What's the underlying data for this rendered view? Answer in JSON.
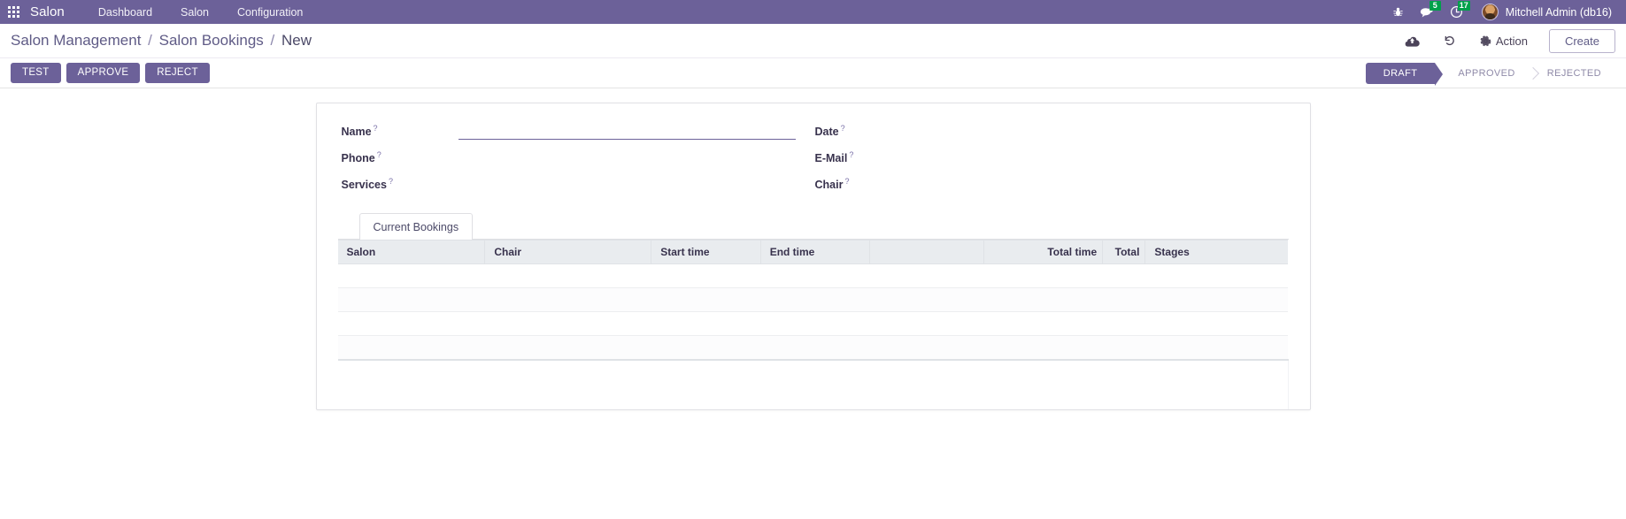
{
  "navbar": {
    "apps_icon": "apps-grid-icon",
    "brand": "Salon",
    "menu": [
      {
        "label": "Dashboard"
      },
      {
        "label": "Salon"
      },
      {
        "label": "Configuration"
      }
    ],
    "debug_icon": "bug-icon",
    "messages_icon": "chat-bubble-icon",
    "messages_count": "5",
    "activities_icon": "clock-icon",
    "activities_count": "17",
    "avatar_icon": "user-avatar",
    "username": "Mitchell Admin (db16)",
    "background_color": "#6c6199",
    "badge_color": "#00a04a"
  },
  "breadcrumb": {
    "root": "Salon Management",
    "parent": "Salon Bookings",
    "current": "New",
    "separator": "/"
  },
  "control_panel": {
    "save_icon": "cloud-upload-icon",
    "discard_icon": "undo-arrow-icon",
    "action_icon": "gear-icon",
    "action_label": "Action",
    "create_label": "Create"
  },
  "statusbar": {
    "buttons": [
      {
        "label": "TEST",
        "name": "test-button"
      },
      {
        "label": "APPROVE",
        "name": "approve-button"
      },
      {
        "label": "REJECT",
        "name": "reject-button"
      }
    ],
    "stages": [
      {
        "label": "DRAFT",
        "active": true
      },
      {
        "label": "APPROVED",
        "active": false
      },
      {
        "label": "REJECTED",
        "active": false
      }
    ],
    "active_color": "#6c6199"
  },
  "form": {
    "help_marker": "?",
    "left": [
      {
        "label": "Name",
        "value": "",
        "placeholder": "",
        "focused": true
      },
      {
        "label": "Phone",
        "value": "",
        "placeholder": "",
        "focused": false
      },
      {
        "label": "Services",
        "value": "",
        "placeholder": "",
        "focused": false
      }
    ],
    "right": [
      {
        "label": "Date",
        "value": "",
        "placeholder": "",
        "focused": false
      },
      {
        "label": "E-Mail",
        "value": "",
        "placeholder": "",
        "focused": false
      },
      {
        "label": "Chair",
        "value": "",
        "placeholder": "",
        "focused": false
      }
    ]
  },
  "notebook": {
    "tabs": [
      {
        "label": "Current Bookings",
        "active": true
      }
    ]
  },
  "bookings_table": {
    "columns": [
      {
        "label": "Salon",
        "align": "left"
      },
      {
        "label": "Chair",
        "align": "left"
      },
      {
        "label": "Start time",
        "align": "left"
      },
      {
        "label": "End time",
        "align": "left"
      },
      {
        "label": "",
        "align": "left"
      },
      {
        "label": "Total time",
        "align": "right"
      },
      {
        "label": "Total",
        "align": "right"
      },
      {
        "label": "Stages",
        "align": "left"
      }
    ],
    "rows": [],
    "empty_row_count": 4
  }
}
